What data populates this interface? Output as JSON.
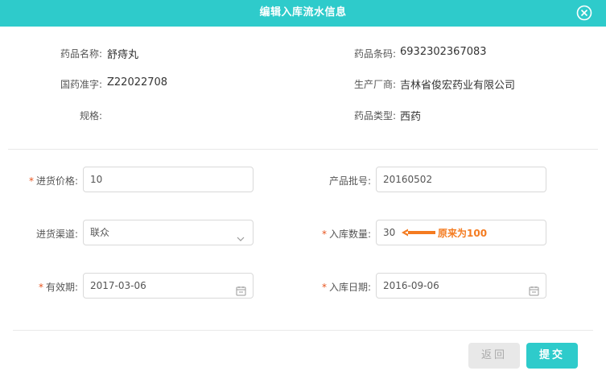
{
  "dialog": {
    "title": "编辑入库流水信息"
  },
  "info": {
    "name": {
      "label": "药品名称:",
      "value": "舒痔丸"
    },
    "barcode": {
      "label": "药品条码:",
      "value": "6932302367083"
    },
    "approval": {
      "label": "国药准字:",
      "value": "Z22022708"
    },
    "maker": {
      "label": "生产厂商:",
      "value": "吉林省俊宏药业有限公司"
    },
    "spec": {
      "label": "规格:",
      "value": ""
    },
    "category": {
      "label": "药品类型:",
      "value": "西药"
    }
  },
  "form": {
    "price": {
      "label": "进货价格",
      "value": "10",
      "required": true
    },
    "batch": {
      "label": "产品批号",
      "value": "20160502",
      "required": false
    },
    "channel": {
      "label": "进货渠道",
      "value": "联众",
      "required": false
    },
    "quantity": {
      "label": "入库数量",
      "value": "30",
      "required": true
    },
    "expiry": {
      "label": "有效期",
      "value": "2017-03-06",
      "required": true
    },
    "instock_date": {
      "label": "入库日期",
      "value": "2016-09-06",
      "required": true
    },
    "colon": ":"
  },
  "annotation": {
    "text": "原来为100",
    "color": "#f47b20"
  },
  "buttons": {
    "back": "返回",
    "submit": "提交"
  },
  "colors": {
    "accent": "#2ecbcb",
    "required": "#e8541e"
  }
}
